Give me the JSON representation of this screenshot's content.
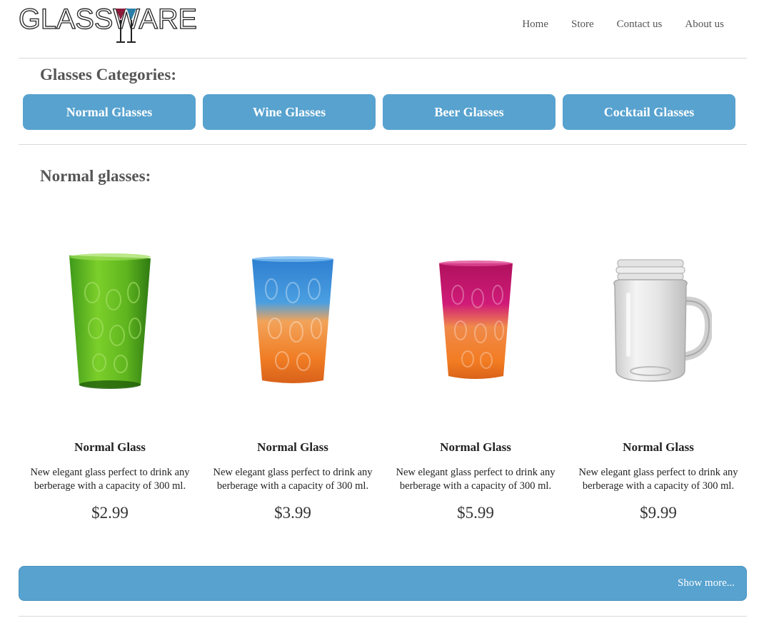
{
  "brand": {
    "logo_text": "GLASSWARE"
  },
  "nav": {
    "items": [
      "Home",
      "Store",
      "Contact us",
      "About us"
    ]
  },
  "categories": {
    "title": "Glasses Categories:",
    "buttons": [
      "Normal Glasses",
      "Wine Glasses",
      "Beer Glasses",
      "Cocktail Glasses"
    ]
  },
  "section": {
    "title": "Normal glasses:"
  },
  "products": [
    {
      "name": "Normal Glass",
      "description": "New elegant glass perfect to drink any berberage with a capacity of 300 ml.",
      "price": "$2.99",
      "image": "green-tumbler"
    },
    {
      "name": "Normal Glass",
      "description": "New elegant glass perfect to drink any berberage with a capacity of 300 ml.",
      "price": "$3.99",
      "image": "blue-orange-tumbler"
    },
    {
      "name": "Normal Glass",
      "description": "New elegant glass perfect to drink any berberage with a capacity of 300 ml.",
      "price": "$5.99",
      "image": "magenta-orange-tumbler"
    },
    {
      "name": "Normal Glass",
      "description": "New elegant glass perfect to drink any berberage with a capacity of 300 ml.",
      "price": "$9.99",
      "image": "clear-mason-jar-mug"
    }
  ],
  "show_more": {
    "label": "Show more..."
  },
  "colors": {
    "accent": "#57a2cf",
    "text": "#555555"
  }
}
